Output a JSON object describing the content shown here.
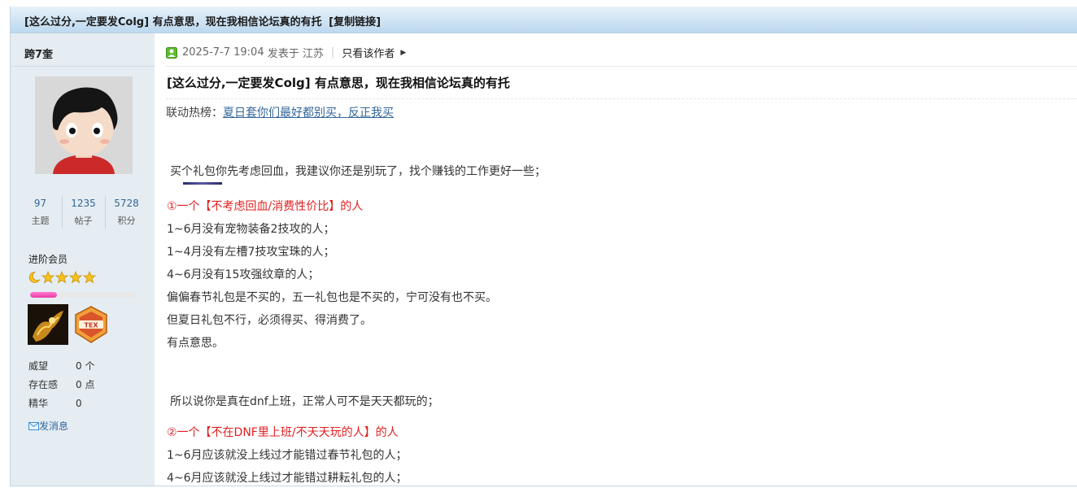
{
  "title_bar": {
    "thread_title": "[这么过分,一定要发Colg] 有点意思，现在我相信论坛真的有托",
    "copy_link": "[复制链接]"
  },
  "author": {
    "username": "跨7奎",
    "stats": [
      {
        "value": "97",
        "label": "主题"
      },
      {
        "value": "1235",
        "label": "帖子"
      },
      {
        "value": "5728",
        "label": "积分"
      }
    ],
    "level": "进阶会员",
    "star_icons": [
      "moon-icon",
      "star-icon",
      "star-icon",
      "star-icon",
      "star-icon"
    ],
    "level_progress": 0.25,
    "info": [
      {
        "key": "威望",
        "value": "0 个"
      },
      {
        "key": "存在感",
        "value": "0 点"
      },
      {
        "key": "精华",
        "value": "0"
      }
    ],
    "send_message": "发消息"
  },
  "post": {
    "meta": {
      "date": "2025-7-7 19:04",
      "posted_at": "发表于",
      "location": "江苏",
      "author_only": "只看该作者"
    },
    "title": "[这么过分,一定要发Colg] 有点意思，现在我相信论坛真的有托",
    "hot_label": "联动热榜：",
    "hot_link": "夏日套你们最好都别买，反正我买",
    "lines": [
      {
        "text": " 买个礼包你先考虑回血，我建议你还是别玩了，找个赚钱的工作更好一些；",
        "red": false
      },
      {
        "text": "①一个【不考虑回血/消费性价比】的人",
        "red": true
      },
      {
        "text": "1~6月没有宠物装备2技攻的人；",
        "red": false
      },
      {
        "text": "1~4月没有左槽7技攻宝珠的人；",
        "red": false
      },
      {
        "text": "4~6月没有15攻强纹章的人；",
        "red": false
      },
      {
        "text": "偏偏春节礼包是不买的，五一礼包也是不买的，宁可没有也不买。",
        "red": false
      },
      {
        "text": "但夏日礼包不行，必须得买、得消费了。",
        "red": false
      },
      {
        "text": "有点意思。",
        "red": false
      },
      {
        "text": "所以说你是真在dnf上班，正常人可不是天天都玩的；",
        "red": false
      },
      {
        "text": "②一个【不在DNF里上班/不天天玩的人】的人",
        "red": true
      },
      {
        "text": "1~6月应该就没上线过才能错过春节礼包的人；",
        "red": false
      },
      {
        "text": "4~6月应该就没上线过才能错过耕耘礼包的人；",
        "red": false
      }
    ]
  }
}
